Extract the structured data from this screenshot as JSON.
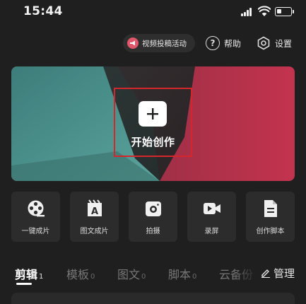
{
  "status_bar": {
    "time": "15:44",
    "icons": [
      "signal-icon",
      "wifi-icon",
      "battery-icon"
    ]
  },
  "header": {
    "activity_label": "视频投稿活动",
    "help_label": "帮助",
    "settings_label": "设置"
  },
  "banner": {
    "start_label": "开始创作",
    "colors": {
      "left": "#4a8f8a",
      "right": "#c0304c"
    }
  },
  "tools": [
    {
      "label": "一键成片",
      "icon": "film-reel-icon"
    },
    {
      "label": "图文成片",
      "icon": "text-image-icon"
    },
    {
      "label": "拍摄",
      "icon": "camera-icon"
    },
    {
      "label": "录屏",
      "icon": "screen-record-icon"
    },
    {
      "label": "创作脚本",
      "icon": "script-icon"
    }
  ],
  "tabs": [
    {
      "label": "剪辑",
      "count": "1",
      "active": true
    },
    {
      "label": "模板",
      "count": "0"
    },
    {
      "label": "图文",
      "count": "0"
    },
    {
      "label": "脚本",
      "count": "0"
    },
    {
      "label": "云备份",
      "count": ""
    }
  ],
  "manage_label": "管理",
  "colors": {
    "background": "#1f1f1f",
    "card": "#2c2c2c",
    "accent_red": "#d5262c"
  }
}
